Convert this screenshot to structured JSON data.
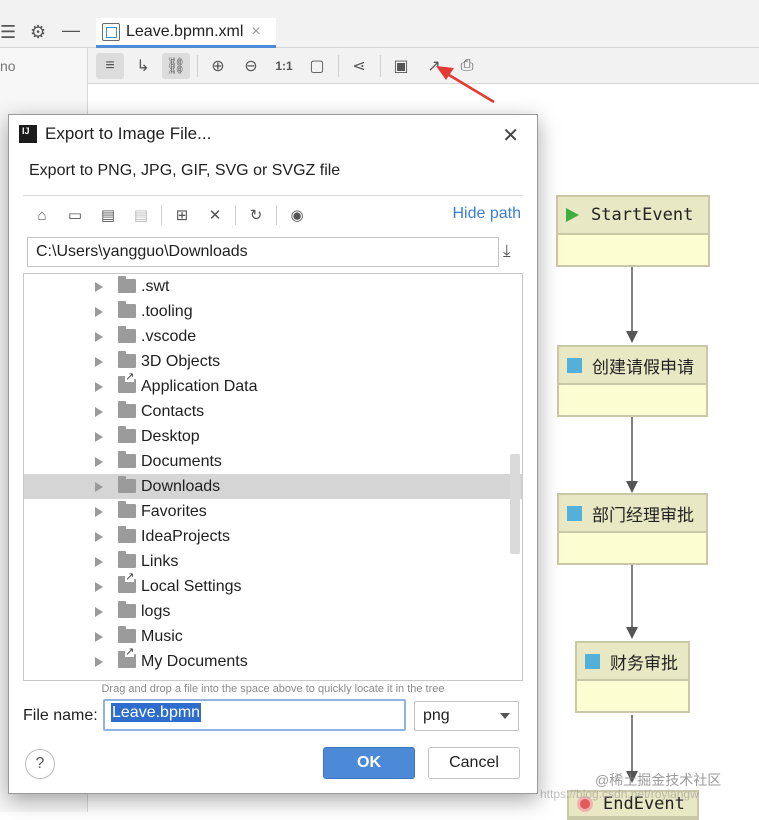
{
  "ide": {
    "tab_title": "Leave.bpmn.xml",
    "tab_close": "×",
    "left_panel_fragment": "no"
  },
  "toolbar": {
    "buttons": [
      "settings-icon",
      "route-icon",
      "link-icon",
      "zoom-in-icon",
      "zoom-out-icon",
      "actual-size-icon",
      "fit-content-icon",
      "share-layout-icon",
      "save-icon",
      "export-image-icon",
      "print-icon"
    ],
    "actual_size_label": "1:1"
  },
  "dialog": {
    "title": "Export to Image File...",
    "close": "✕",
    "subtitle": "Export to PNG, JPG, GIF, SVG or SVGZ file",
    "hide_path": "Hide path",
    "path_value": "C:\\Users\\yangguo\\Downloads",
    "tree_items": [
      {
        "label": ".swt",
        "link": false
      },
      {
        "label": ".tooling",
        "link": false
      },
      {
        "label": ".vscode",
        "link": false
      },
      {
        "label": "3D Objects",
        "link": false
      },
      {
        "label": "Application Data",
        "link": true
      },
      {
        "label": "Contacts",
        "link": false
      },
      {
        "label": "Desktop",
        "link": false
      },
      {
        "label": "Documents",
        "link": false
      },
      {
        "label": "Downloads",
        "link": false,
        "selected": true
      },
      {
        "label": "Favorites",
        "link": false
      },
      {
        "label": "IdeaProjects",
        "link": false
      },
      {
        "label": "Links",
        "link": false
      },
      {
        "label": "Local Settings",
        "link": true
      },
      {
        "label": "logs",
        "link": false
      },
      {
        "label": "Music",
        "link": false
      },
      {
        "label": "My Documents",
        "link": true
      }
    ],
    "drag_hint": "Drag and drop a file into the space above to quickly locate it in the tree",
    "file_name_label": "File name:",
    "file_name_value": "Leave.bpmn",
    "format_value": "png",
    "help": "?",
    "ok": "OK",
    "cancel": "Cancel"
  },
  "diagram": {
    "start_event": "StartEvent",
    "task_1": "创建请假申请",
    "task_2": "部门经理审批",
    "task_3": "财务审批",
    "end_event": "EndEvent"
  },
  "watermark": {
    "line1": "@稀土掘金技术社区",
    "line2": "https://blog.csdn.net/royiangw"
  },
  "colors": {
    "accent": "#4c8ad8",
    "node_fill": "#fdfdd2",
    "node_header": "#e8e8c4",
    "arrow_red": "#e53935"
  }
}
